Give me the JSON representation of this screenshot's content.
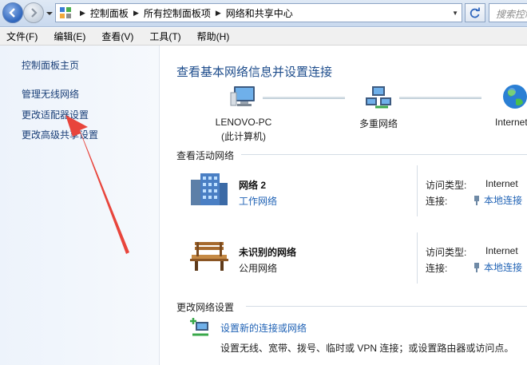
{
  "address_bar": {
    "breadcrumbs": [
      "控制面板",
      "所有控制面板项",
      "网络和共享中心"
    ],
    "search_placeholder": "搜索控制面板"
  },
  "menu": [
    "文件(F)",
    "编辑(E)",
    "查看(V)",
    "工具(T)",
    "帮助(H)"
  ],
  "sidebar": {
    "items": [
      "控制面板主页",
      "管理无线网络",
      "更改适配器设置",
      "更改高级共享设置"
    ]
  },
  "main": {
    "title": "查看基本网络信息并设置连接",
    "network_map": {
      "computer_name": "LENOVO-PC",
      "computer_sub": "(此计算机)",
      "middle": "多重网络",
      "internet": "Internet"
    },
    "active_networks_heading": "查看活动网络",
    "networks": [
      {
        "name": "网络  2",
        "type": "工作网络",
        "access_label": "访问类型:",
        "access_value": "Internet",
        "conn_label": "连接:",
        "conn_value": "本地连接"
      },
      {
        "name": "未识别的网络",
        "type": "公用网络",
        "access_label": "访问类型:",
        "access_value": "Internet",
        "conn_label": "连接:",
        "conn_value": "本地连接"
      }
    ],
    "change_settings_heading": "更改网络设置",
    "task": {
      "link": "设置新的连接或网络",
      "desc": "设置无线、宽带、拨号、临时或 VPN 连接；或设置路由器或访问点。"
    }
  },
  "colors": {
    "link": "#1f62b5",
    "title": "#1e4d8c",
    "annotation_arrow": "#e8453c"
  }
}
